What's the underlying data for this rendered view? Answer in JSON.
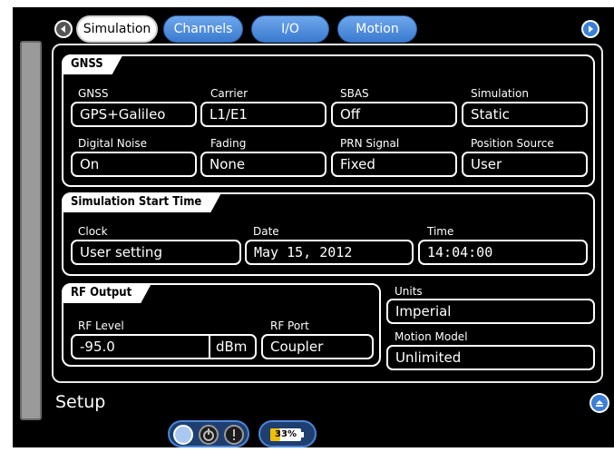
{
  "nav": {
    "tabs": [
      {
        "label": "Simulation",
        "active": true
      },
      {
        "label": "Channels",
        "active": false
      },
      {
        "label": "I/O",
        "active": false
      },
      {
        "label": "Motion",
        "active": false
      }
    ],
    "back_icon": "left-arrow-icon",
    "forward_icon": "right-arrow-icon"
  },
  "gnss": {
    "title": "GNSS",
    "gnss_label": "GNSS",
    "gnss_value": "GPS+Galileo",
    "carrier_label": "Carrier",
    "carrier_value": "L1/E1",
    "sbas_label": "SBAS",
    "sbas_value": "Off",
    "simulation_label": "Simulation",
    "simulation_value": "Static",
    "digital_noise_label": "Digital Noise",
    "digital_noise_value": "On",
    "fading_label": "Fading",
    "fading_value": "None",
    "prn_signal_label": "PRN Signal",
    "prn_signal_value": "Fixed",
    "position_source_label": "Position Source",
    "position_source_value": "User"
  },
  "start_time": {
    "title": "Simulation Start Time",
    "clock_label": "Clock",
    "clock_value": "User setting",
    "date_label": "Date",
    "date_value": "May 15, 2012",
    "time_label": "Time",
    "time_value": "14:04:00"
  },
  "rf_output": {
    "title": "RF Output",
    "level_label": "RF Level",
    "level_value": "-95.0",
    "level_unit": "dBm",
    "port_label": "RF Port",
    "port_value": "Coupler"
  },
  "units": {
    "label": "Units",
    "value": "Imperial"
  },
  "motion_model": {
    "label": "Motion Model",
    "value": "Unlimited"
  },
  "footer": {
    "setup_label": "Setup",
    "collapse_icon": "collapse-up-icon",
    "battery_percent": "33%",
    "battery_level": 0.33,
    "status_icons": [
      "status-circle-icon",
      "power-icon",
      "alert-icon"
    ]
  },
  "colors": {
    "accent": "#3b7fd6",
    "battery": "#f0c000",
    "background": "#000000"
  }
}
